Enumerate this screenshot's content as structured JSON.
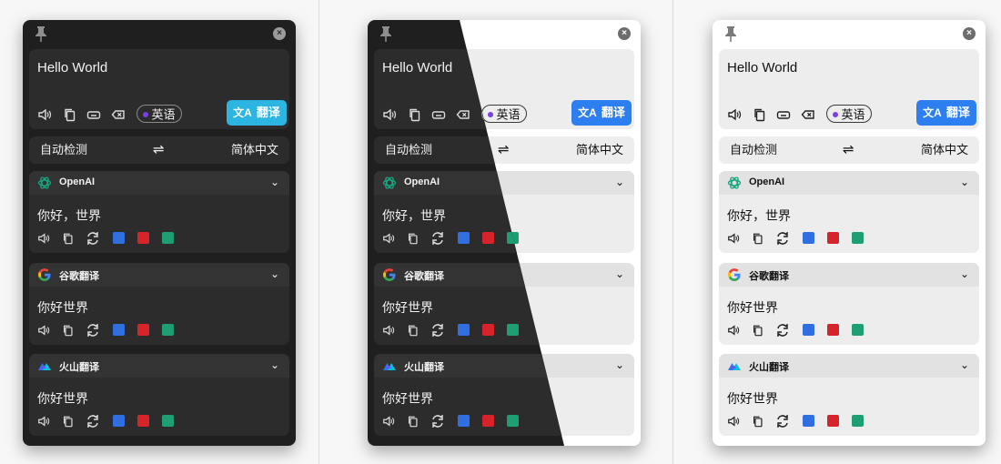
{
  "windows": [
    {
      "variant": "dark"
    },
    {
      "variant": "split"
    },
    {
      "variant": "light"
    }
  ],
  "input": {
    "text": "Hello World",
    "detected_lang": "英语",
    "detected_dot_color": "#7b3fe4",
    "translate_label": "翻译",
    "translate_icon": "文A"
  },
  "translate_button_colors": {
    "dark": "#2bb5e0",
    "light": "#2d7ff0"
  },
  "language_bar": {
    "source": "自动检测",
    "swap": "⇌",
    "target": "简体中文"
  },
  "services": [
    {
      "name": "OpenAI",
      "result": "你好，世界",
      "logo_icon": "openai-icon"
    },
    {
      "name": "谷歌翻译",
      "result": "你好世界",
      "logo_icon": "google-icon"
    },
    {
      "name": "火山翻译",
      "result": "你好世界",
      "logo_icon": "volcano-icon"
    }
  ],
  "collapse_glyph": "⌄",
  "close_glyph": "×",
  "input_icons": [
    "speaker-icon",
    "copy-icon",
    "keyboard-icon",
    "clear-icon"
  ],
  "result_icons": [
    "speaker-icon",
    "copy-icon",
    "retranslate-icon",
    "dictionary-blue-icon",
    "dictionary-red-icon",
    "dictionary-green-icon"
  ],
  "result_icon_colors": {
    "blue": "#2f6fe0",
    "red": "#d7242a",
    "green": "#1d9e73"
  }
}
